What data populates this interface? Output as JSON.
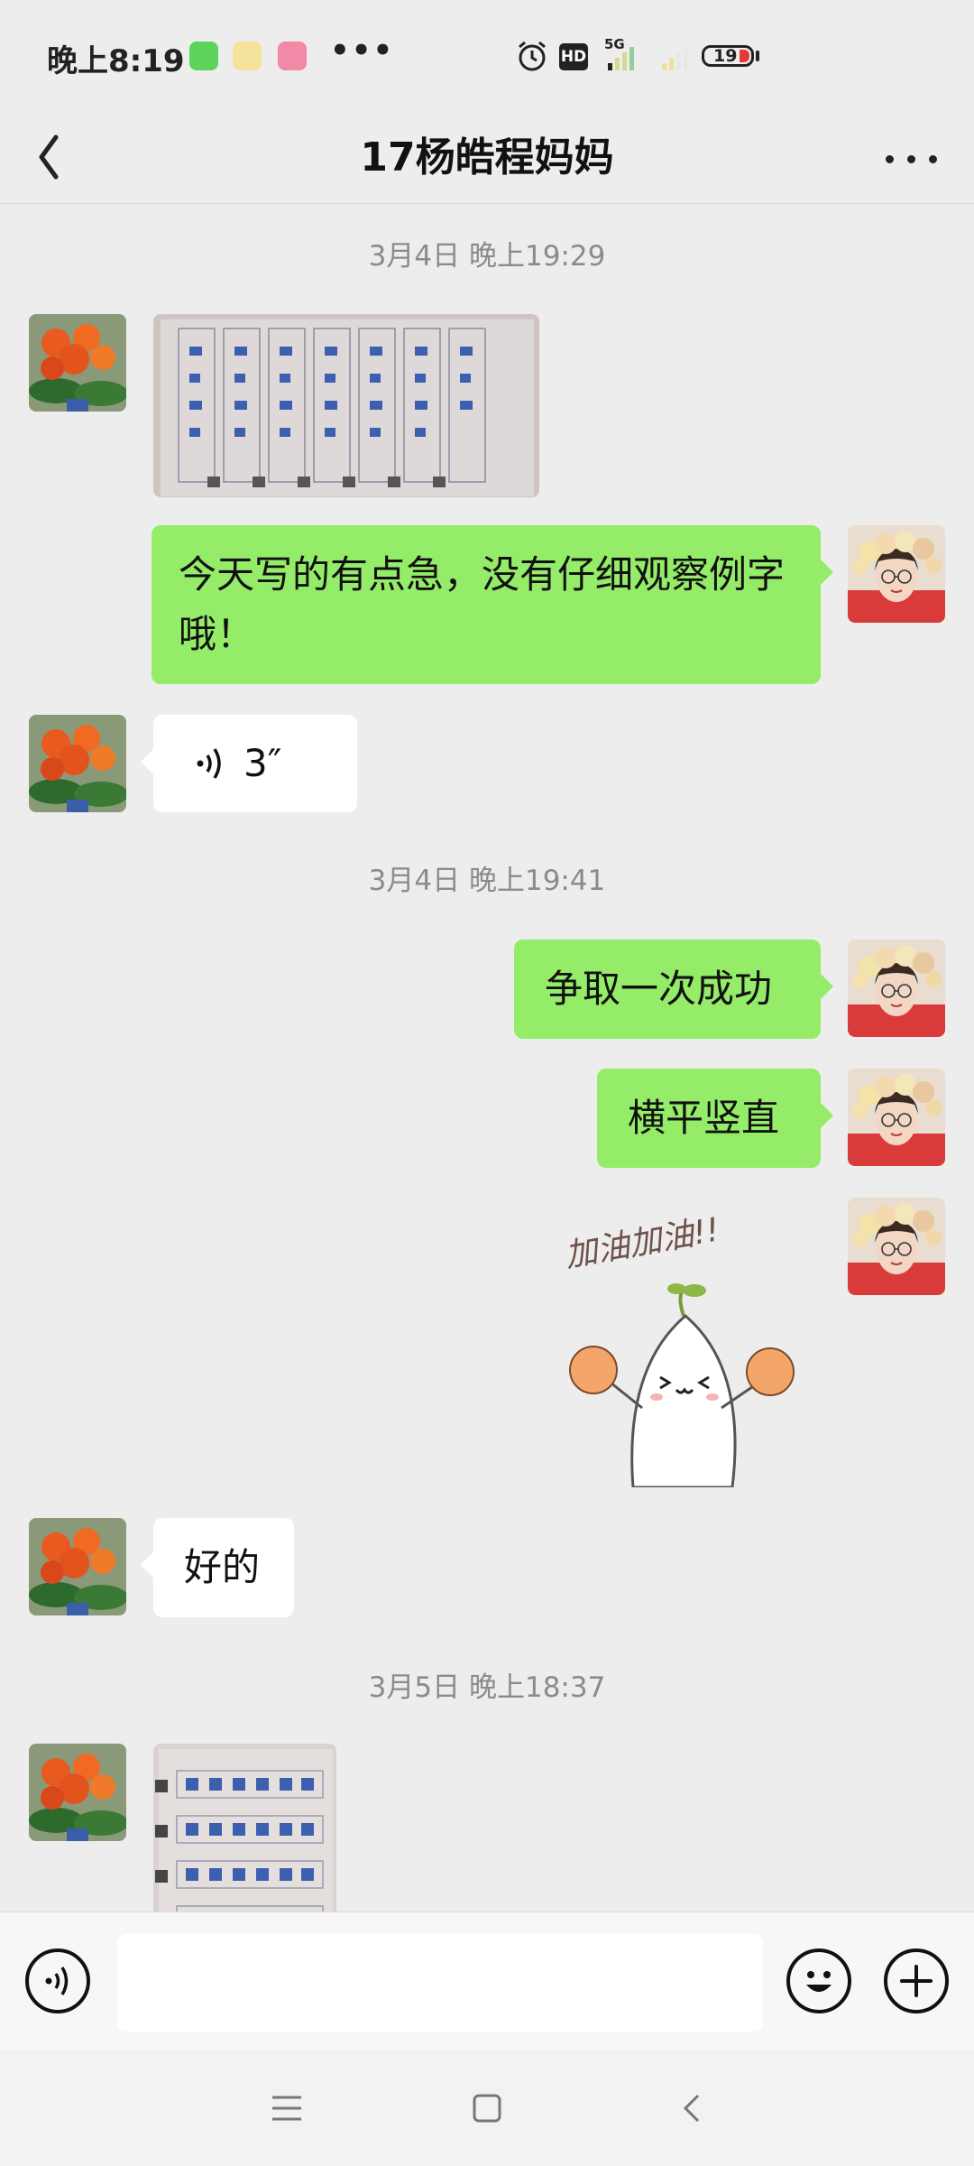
{
  "status_bar": {
    "time": "晚上8:19",
    "more": "•••",
    "network": "5G",
    "hd": "HD",
    "battery": "19"
  },
  "title_bar": {
    "title": "17杨皓程妈妈"
  },
  "chat": {
    "timestamps": [
      "3月4日 晚上19:29",
      "3月4日 晚上19:41",
      "3月5日 晚上18:37"
    ],
    "messages": {
      "m1_text": "今天写的有点急，没有仔细观察例字哦！",
      "voice_duration": "3″",
      "m2_text": "争取一次成功",
      "m3_text": "横平竖直",
      "sticker_text": "加油加油!!",
      "m4_text": "好的"
    }
  },
  "colors": {
    "outgoing_bubble": "#95ec69",
    "incoming_bubble": "#ffffff",
    "background": "#ededed"
  },
  "icons": {
    "back": "chevron-left-icon",
    "more": "more-horizontal-icon",
    "voice": "voice-input-icon",
    "emoji": "emoji-icon",
    "plus": "plus-icon"
  }
}
